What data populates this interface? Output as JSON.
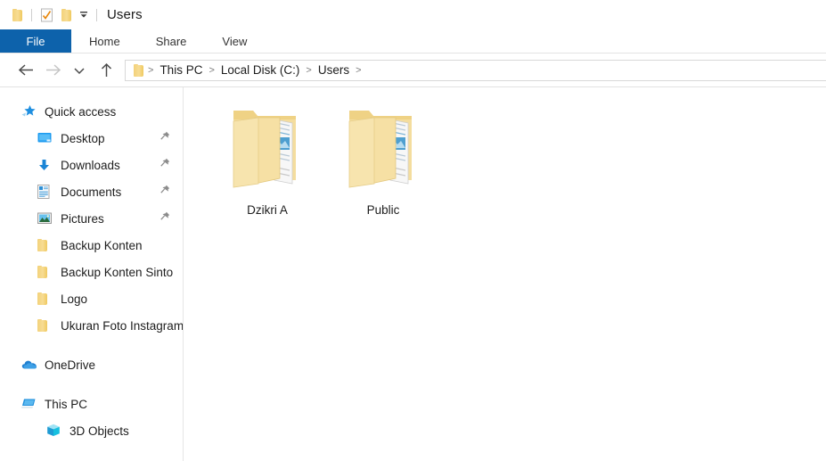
{
  "window": {
    "title": "Users",
    "quick_access_toolbar": [
      {
        "name": "folder-icon",
        "label": "Folder"
      },
      {
        "name": "properties-icon",
        "label": "Properties"
      },
      {
        "name": "new-folder-icon",
        "label": "New folder"
      },
      {
        "name": "customize-caret-icon",
        "label": "Customize Quick Access Toolbar"
      }
    ]
  },
  "ribbon": {
    "tabs": [
      {
        "label": "File",
        "active": true
      },
      {
        "label": "Home",
        "active": false
      },
      {
        "label": "Share",
        "active": false
      },
      {
        "label": "View",
        "active": false
      }
    ]
  },
  "nav": {
    "back": "Back",
    "forward": "Forward",
    "recent": "Recent locations",
    "up": "Up",
    "breadcrumbs": [
      "This PC",
      "Local Disk (C:)",
      "Users"
    ],
    "separator": ">"
  },
  "sidebar": {
    "groups": [
      {
        "header": {
          "label": "Quick access",
          "icon": "quick-access-star-icon"
        },
        "items": [
          {
            "label": "Desktop",
            "icon": "desktop-icon",
            "pinned": true,
            "level": 1
          },
          {
            "label": "Downloads",
            "icon": "downloads-icon",
            "pinned": true,
            "level": 1
          },
          {
            "label": "Documents",
            "icon": "documents-icon",
            "pinned": true,
            "level": 1
          },
          {
            "label": "Pictures",
            "icon": "pictures-icon",
            "pinned": true,
            "level": 1
          },
          {
            "label": "Backup Konten",
            "icon": "folder-icon",
            "pinned": false,
            "level": 1
          },
          {
            "label": "Backup Konten Sinto",
            "icon": "folder-icon",
            "pinned": false,
            "level": 1
          },
          {
            "label": "Logo",
            "icon": "folder-icon",
            "pinned": false,
            "level": 1
          },
          {
            "label": "Ukuran Foto Instagram",
            "icon": "folder-icon",
            "pinned": false,
            "level": 1
          }
        ]
      },
      {
        "header": {
          "label": "OneDrive",
          "icon": "onedrive-cloud-icon"
        },
        "items": []
      },
      {
        "header": {
          "label": "This PC",
          "icon": "this-pc-icon"
        },
        "items": [
          {
            "label": "3D Objects",
            "icon": "3d-objects-icon",
            "pinned": false,
            "level": 2
          }
        ]
      }
    ]
  },
  "content": {
    "items": [
      {
        "name": "Dzikri A",
        "icon": "folder-large-icon"
      },
      {
        "name": "Public",
        "icon": "folder-large-icon"
      }
    ]
  },
  "colors": {
    "accent": "#0d62ab",
    "folder": "#f5dc9a",
    "text": "#1d1d1d",
    "divider": "#e6e6e6"
  }
}
